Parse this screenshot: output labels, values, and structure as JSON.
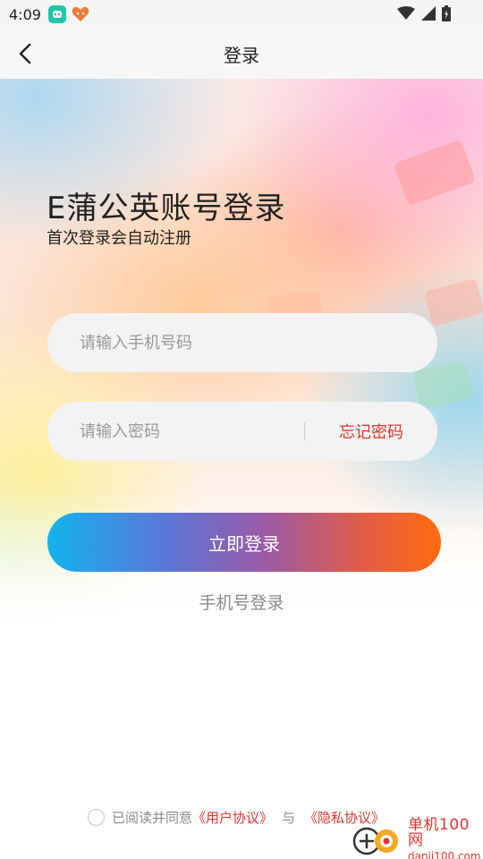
{
  "status_bar": {
    "time": "4:09",
    "icons": [
      "app-icon-green",
      "app-icon-heart",
      "wifi-icon",
      "signal-icon",
      "battery-icon"
    ]
  },
  "nav": {
    "back_icon": "chevron-left-icon",
    "title": "登录"
  },
  "login": {
    "heading": "E蒲公英账号登录",
    "subheading": "首次登录会自动注册",
    "phone_placeholder": "请输入手机号码",
    "phone_value": "",
    "password_placeholder": "请输入密码",
    "password_value": "",
    "forgot_label": "忘记密码",
    "submit_label": "立即登录",
    "alt_login_label": "手机号登录"
  },
  "agreement": {
    "checked": false,
    "prefix": "已阅读并同意",
    "user_agreement": "《用户协议》",
    "connector": "与",
    "privacy_policy": "《隐私协议》"
  },
  "watermark": {
    "name": "单机100网",
    "url": "danji100.com"
  },
  "colors": {
    "accent_red": "#e8322b",
    "button_gradient_start": "#12b3ee",
    "button_gradient_end": "#ff6a10",
    "input_bg": "#f3f3f3"
  }
}
